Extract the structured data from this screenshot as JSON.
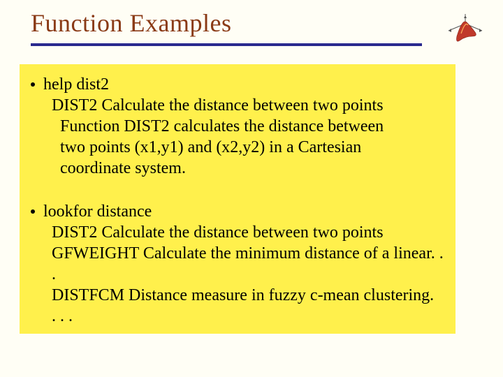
{
  "title": "Function Examples",
  "section1": {
    "cmd": "help dist2",
    "line1": "DIST2 Calculate the distance between two points",
    "line2": "Function DIST2 calculates the distance between",
    "line3": "two points (x1,y1) and (x2,y2) in a Cartesian",
    "line4": "coordinate system."
  },
  "section2": {
    "cmd": "lookfor distance",
    "line1": "DIST2 Calculate the distance between two points",
    "line2": "GFWEIGHT Calculate the minimum distance of a linear. . .",
    "line3": "DISTFCM Distance measure in fuzzy c-mean clustering.",
    "line4": ". . ."
  }
}
